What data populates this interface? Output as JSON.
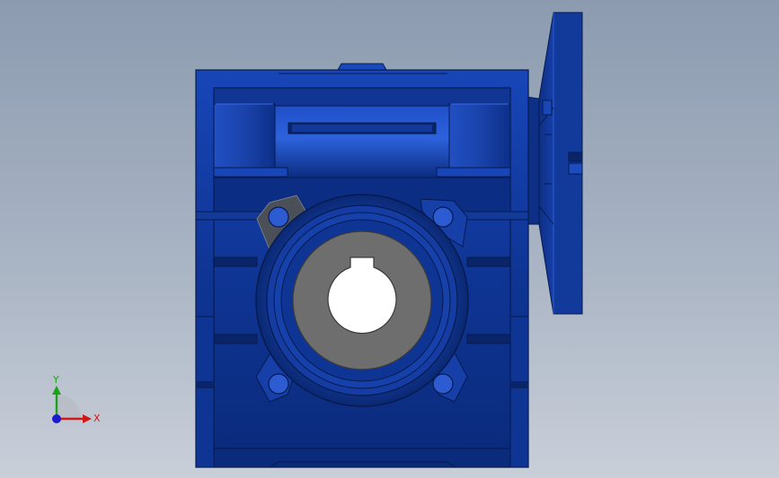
{
  "scene": {
    "description_label": "",
    "colors": {
      "background_top": "#8c9bb0",
      "background_bottom": "#c9cfd9",
      "housing_dark": "#0b2a78",
      "housing_mid": "#123a9a",
      "housing_light": "#2a5ad0",
      "housing_edge": "#061a4e",
      "bore_gray": "#6e6e6e",
      "bore_edge": "#3a3a3a",
      "flange_gray": "#4b4f58"
    }
  },
  "triad": {
    "y_label": "Y",
    "x_label": "X",
    "y_color": "#1aa31a",
    "x_color": "#d01818",
    "z_color": "#1a1ad0"
  }
}
